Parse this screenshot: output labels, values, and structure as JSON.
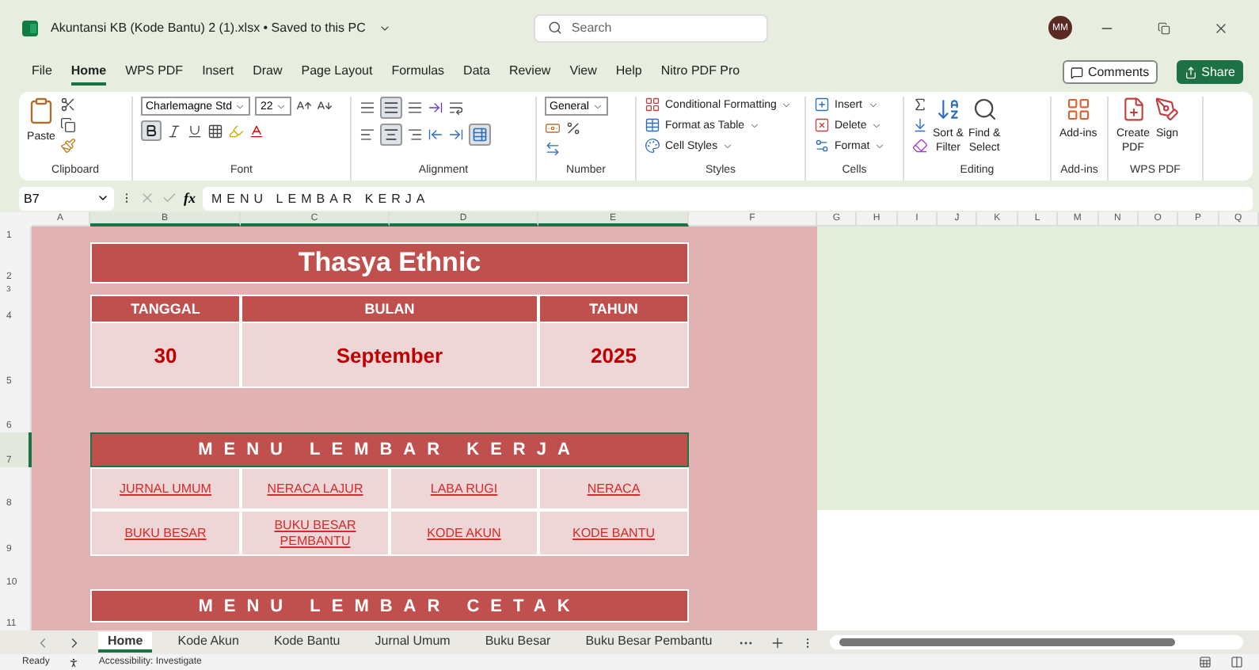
{
  "window": {
    "title": "Akuntansi KB (Kode Bantu) 2 (1).xlsx • Saved to this PC",
    "search_placeholder": "Search",
    "avatar": "MM"
  },
  "menu_tabs": [
    {
      "label": "File",
      "selected": false
    },
    {
      "label": "Home",
      "selected": true
    },
    {
      "label": "WPS PDF",
      "selected": false
    },
    {
      "label": "Insert",
      "selected": false
    },
    {
      "label": "Draw",
      "selected": false
    },
    {
      "label": "Page Layout",
      "selected": false
    },
    {
      "label": "Formulas",
      "selected": false
    },
    {
      "label": "Data",
      "selected": false
    },
    {
      "label": "Review",
      "selected": false
    },
    {
      "label": "View",
      "selected": false
    },
    {
      "label": "Help",
      "selected": false
    },
    {
      "label": "Nitro PDF Pro",
      "selected": false
    }
  ],
  "top_buttons": [
    {
      "kind": "comments",
      "label": "Comments"
    },
    {
      "kind": "share",
      "label": "Share"
    }
  ],
  "ribbon": [
    {
      "kind": "clipboard",
      "label": "Clipboard",
      "items": [
        "Paste"
      ]
    },
    {
      "kind": "font",
      "label": "Font",
      "font_name": "Charlemagne Std",
      "font_size": "22",
      "bold": true
    },
    {
      "kind": "alignment",
      "label": "Alignment",
      "center": true
    },
    {
      "kind": "number",
      "label": "Number",
      "format": "General"
    },
    {
      "kind": "styles",
      "label": "Styles",
      "items": [
        "Conditional Formatting",
        "Format as Table",
        "Cell Styles"
      ]
    },
    {
      "kind": "cells",
      "label": "Cells",
      "items": [
        "Insert",
        "Delete",
        "Format"
      ]
    },
    {
      "kind": "editing",
      "label": "Editing",
      "items": [
        "Sort &",
        "Filter",
        "Find &",
        "Select"
      ]
    },
    {
      "kind": "addins",
      "label": "Add-ins",
      "items": [
        "Add-ins"
      ]
    },
    {
      "kind": "pdf",
      "label": "WPS PDF",
      "items": [
        "Create",
        "PDF",
        "Sign"
      ]
    }
  ],
  "formula_bar": {
    "name_box": "B7",
    "function_label": "fx",
    "formula": "MENU LEMBAR KERJA"
  },
  "columns": [
    {
      "label": "A",
      "selected": false
    },
    {
      "label": "B",
      "selected": true
    },
    {
      "label": "C",
      "selected": true
    },
    {
      "label": "D",
      "selected": true
    },
    {
      "label": "E",
      "selected": true
    },
    {
      "label": "F",
      "selected": false
    },
    {
      "label": "G",
      "selected": false
    },
    {
      "label": "H",
      "selected": false
    },
    {
      "label": "I",
      "selected": false
    },
    {
      "label": "J",
      "selected": false
    },
    {
      "label": "K",
      "selected": false
    },
    {
      "label": "L",
      "selected": false
    },
    {
      "label": "M",
      "selected": false
    },
    {
      "label": "N",
      "selected": false
    },
    {
      "label": "O",
      "selected": false
    },
    {
      "label": "P",
      "selected": false
    },
    {
      "label": "Q",
      "selected": false
    }
  ],
  "rows": [
    {
      "label": "1",
      "selected": false
    },
    {
      "label": "2",
      "selected": false
    },
    {
      "label": "3",
      "selected": false
    },
    {
      "label": "4",
      "selected": false
    },
    {
      "label": "5",
      "selected": false
    },
    {
      "label": "6",
      "selected": false
    },
    {
      "label": "7",
      "selected": true
    },
    {
      "label": "8",
      "selected": false
    },
    {
      "label": "9",
      "selected": false
    },
    {
      "label": "10",
      "selected": false
    },
    {
      "label": "11",
      "selected": false
    }
  ],
  "sheet": {
    "title": "Thasya Ethnic",
    "date_headers": [
      "TANGGAL",
      "BULAN",
      "TAHUN"
    ],
    "date_values": [
      "30",
      "September",
      "2025"
    ],
    "menu_kerja": {
      "title": "MENU LEMBAR KERJA",
      "links": [
        "JURNAL UMUM",
        "NERACA LAJUR",
        "LABA RUGI",
        "NERACA",
        "BUKU BESAR",
        "BUKU BESAR PEMBANTU",
        "KODE AKUN",
        "KODE BANTU"
      ]
    },
    "menu_cetak": {
      "title": "MENU LEMBAR CETAK"
    }
  },
  "sheet_tabs": [
    {
      "label": "Home",
      "selected": true
    },
    {
      "label": "Kode Akun",
      "selected": false
    },
    {
      "label": "Kode Bantu",
      "selected": false
    },
    {
      "label": "Jurnal Umum",
      "selected": false
    },
    {
      "label": "Buku Besar",
      "selected": false
    },
    {
      "label": "Buku Besar Pembantu",
      "selected": false
    }
  ],
  "status_bar": {
    "ready": "Ready",
    "accessibility": "Accessibility: Investigate"
  }
}
